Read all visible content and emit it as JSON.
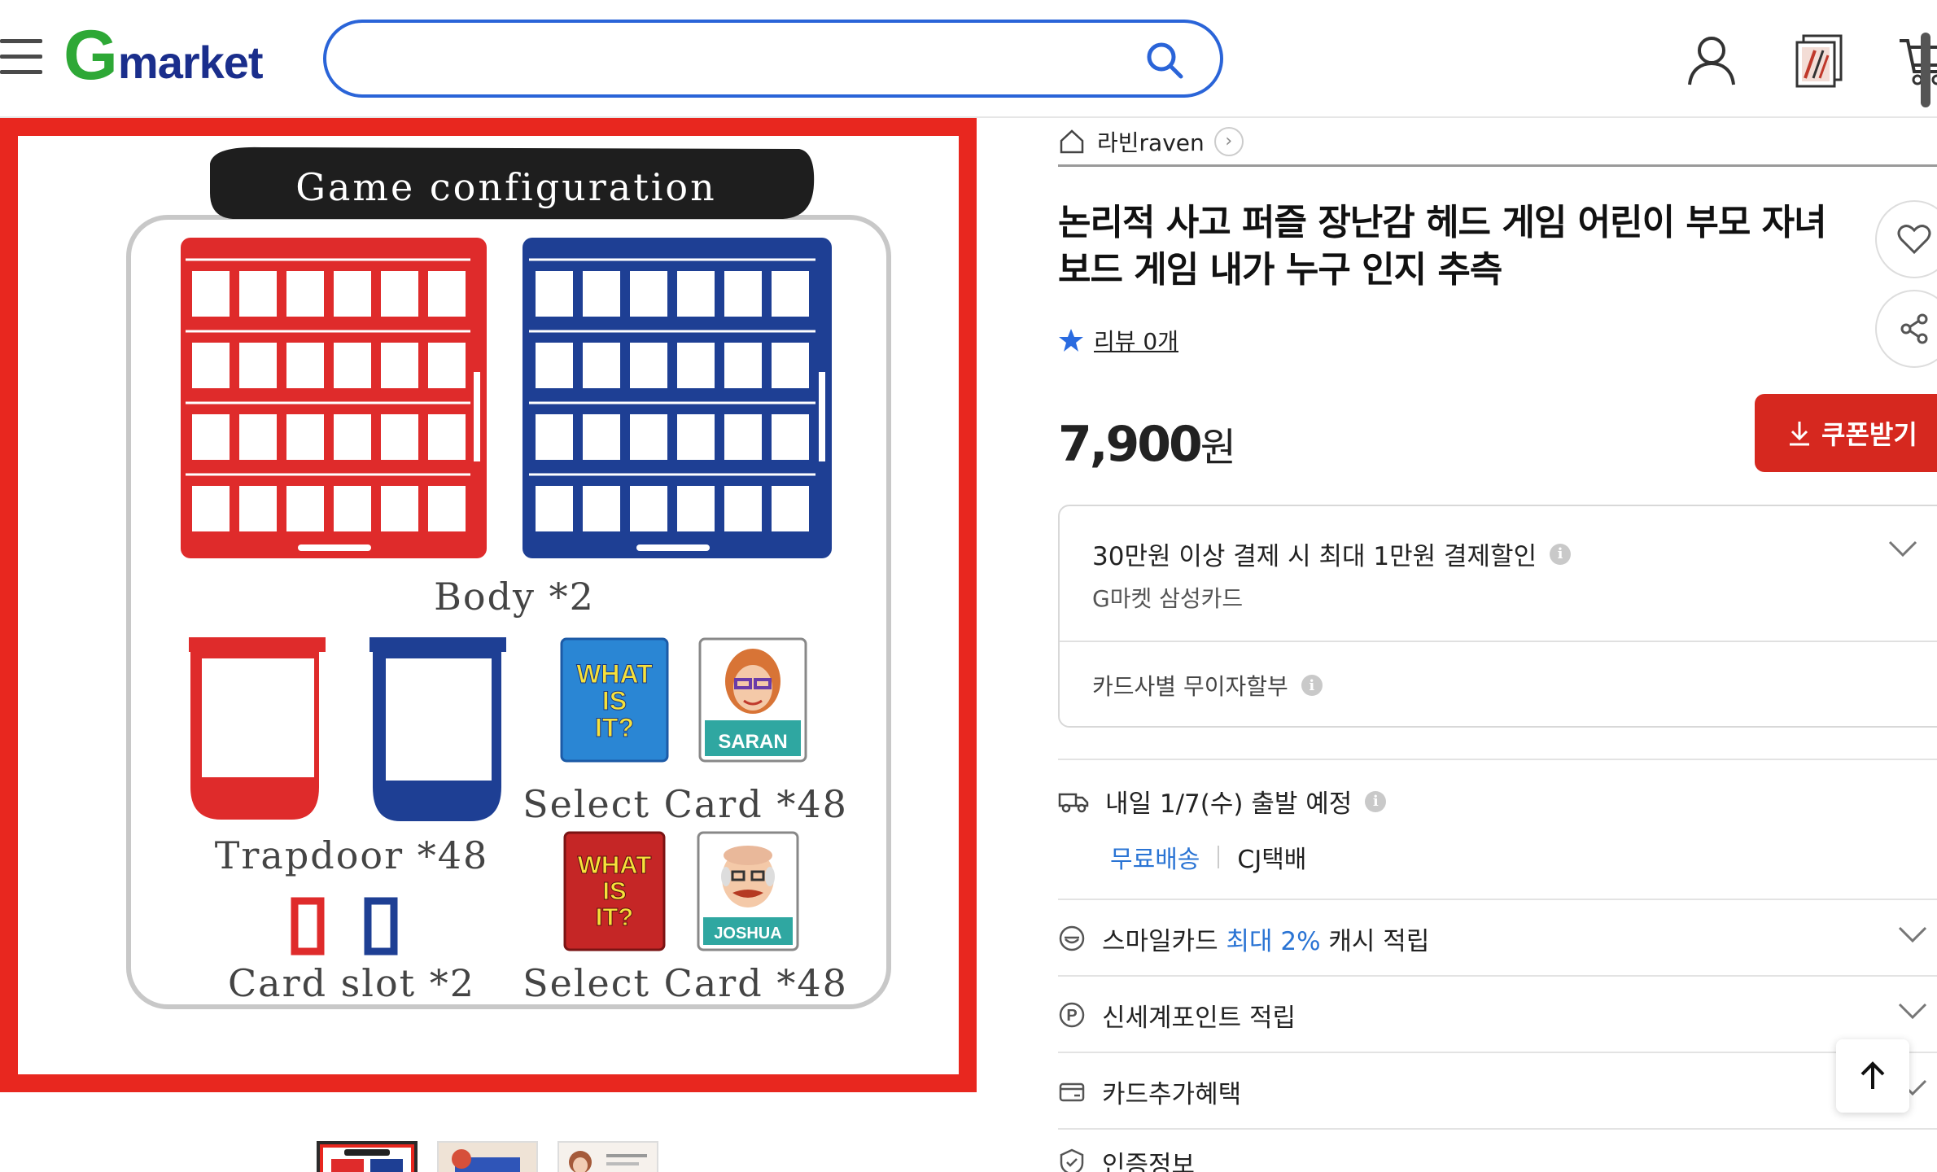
{
  "header": {
    "logo_g": "G",
    "logo_rest": "market",
    "search_value": "",
    "search_placeholder": ""
  },
  "product_image": {
    "header_label": "Game configuration",
    "body_label": "Body *2",
    "trapdoor_label": "Trapdoor *48",
    "card_slot_label": "Card slot *2",
    "select_card_label_1": "Select Card *48",
    "select_card_label_2": "Select Card *48",
    "what_is_it": "WHAT IS IT?",
    "character_1": "SARAN",
    "character_2": "JOSHUA"
  },
  "thumbnails": [
    {
      "name": "thumbnail-1",
      "active": true
    },
    {
      "name": "thumbnail-2",
      "active": false
    },
    {
      "name": "thumbnail-3",
      "active": false
    }
  ],
  "seller": {
    "name": "라빈raven",
    "chevron": "›"
  },
  "product": {
    "title": "논리적 사고 퍼즐 장난감 헤드 게임 어린이 부모 자녀 보드 게임 내가 누구 인지 추측",
    "review_text": "리뷰 0개",
    "price_number": "7,900",
    "price_unit": "원",
    "coupon_label": "쿠폰받기"
  },
  "promo": {
    "title": "30만원 이상 결제 시 최대 1만원 결제할인",
    "subtitle": "G마켓 삼성카드",
    "installment": "카드사별 무이자할부",
    "info_glyph": "i"
  },
  "shipping": {
    "departure": "내일 1/7(수) 출발 예정",
    "free_shipping": "무료배송",
    "carrier": "CJ택배"
  },
  "benefits": {
    "smilecard_prefix": "스마일카드 ",
    "smilecard_highlight": "최대 2%",
    "smilecard_suffix": " 캐시 적립",
    "shinsegae_point": "신세계포인트 적립",
    "card_benefit": "카드추가혜택",
    "certification": "인증정보"
  },
  "colors": {
    "brand_green": "#2ea836",
    "brand_navy": "#1a2e8c",
    "search_border": "#2a64d8",
    "coupon_red": "#d6281f",
    "link_blue": "#2a74d4",
    "star_blue": "#2a6be0"
  }
}
